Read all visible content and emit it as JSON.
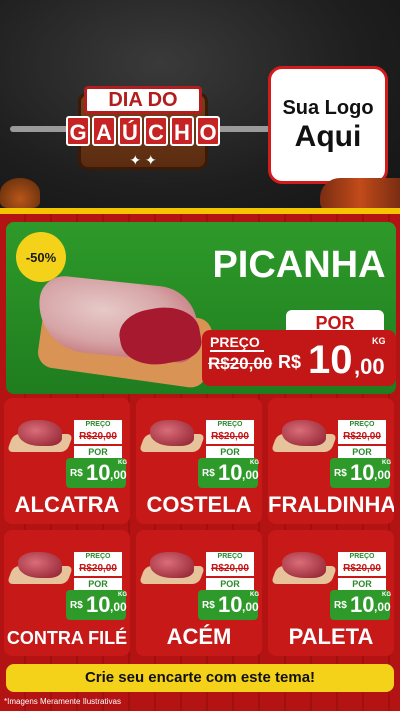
{
  "header": {
    "badge_line1": "DIA DO",
    "badge_letters": [
      "G",
      "A",
      "Ú",
      "C",
      "H",
      "O"
    ],
    "logo_line1": "Sua Logo",
    "logo_line2": "Aqui"
  },
  "hero": {
    "discount": "-50%",
    "name": "PICANHA",
    "por_label": "POR",
    "preco_label": "PREÇO",
    "old_price": "R$20,00",
    "currency": "R$",
    "price_int": "10",
    "price_cents": ",00",
    "unit": "KG"
  },
  "cards": [
    {
      "name": "ALCATRA",
      "preco_label": "PREÇO",
      "old_price": "R$20,00",
      "por_label": "POR",
      "currency": "R$",
      "price_int": "10",
      "price_cents": ",00",
      "unit": "KG"
    },
    {
      "name": "COSTELA",
      "preco_label": "PREÇO",
      "old_price": "R$20,00",
      "por_label": "POR",
      "currency": "R$",
      "price_int": "10",
      "price_cents": ",00",
      "unit": "KG"
    },
    {
      "name": "FRALDINHA",
      "preco_label": "PREÇO",
      "old_price": "R$20,00",
      "por_label": "POR",
      "currency": "R$",
      "price_int": "10",
      "price_cents": ",00",
      "unit": "KG"
    },
    {
      "name": "CONTRA FILÉ",
      "preco_label": "PREÇO",
      "old_price": "R$20,00",
      "por_label": "POR",
      "currency": "R$",
      "price_int": "10",
      "price_cents": ",00",
      "unit": "KG"
    },
    {
      "name": "ACÉM",
      "preco_label": "PREÇO",
      "old_price": "R$20,00",
      "por_label": "POR",
      "currency": "R$",
      "price_int": "10",
      "price_cents": ",00",
      "unit": "KG"
    },
    {
      "name": "PALETA",
      "preco_label": "PREÇO",
      "old_price": "R$20,00",
      "por_label": "POR",
      "currency": "R$",
      "price_int": "10",
      "price_cents": ",00",
      "unit": "KG"
    }
  ],
  "cta": "Crie seu encarte com este tema!",
  "footnote": "*Imagens Meramente Ilustrativas",
  "colors": {
    "red": "#c81919",
    "green": "#2e9a2a",
    "yellow": "#f5d21a"
  }
}
